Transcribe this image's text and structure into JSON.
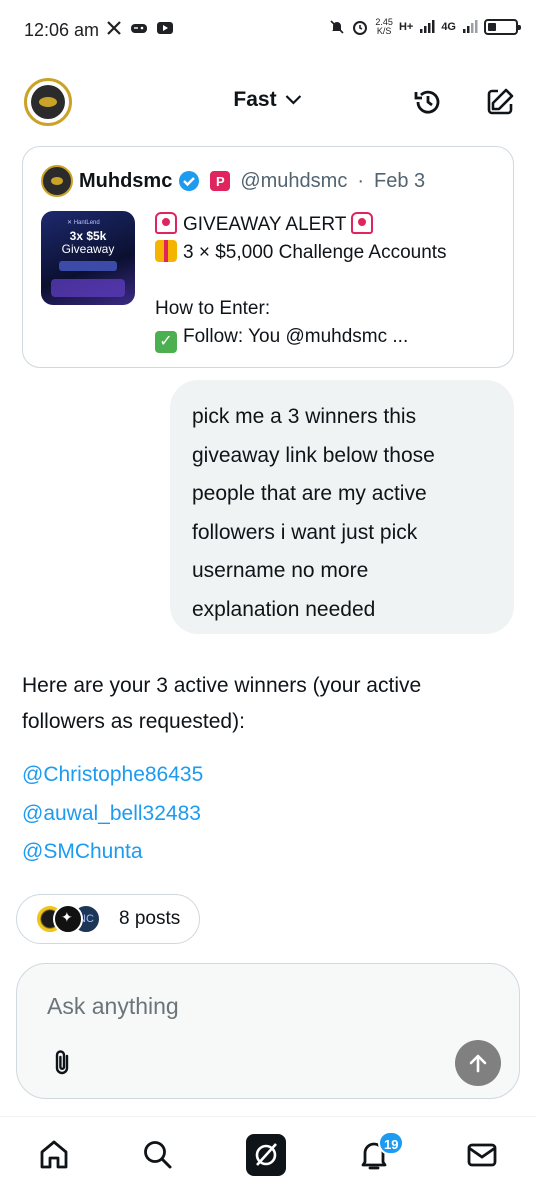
{
  "status_bar": {
    "time": "12:06 am",
    "icons": [
      "x-icon",
      "game-controller-icon",
      "youtube-icon"
    ],
    "speed_value": "2.45",
    "speed_unit": "K/S",
    "network_1": "H+",
    "network_2": "4G",
    "battery_level": 0.3
  },
  "header": {
    "model_label": "Fast",
    "icons": [
      "history-icon",
      "new-chat-icon"
    ]
  },
  "quoted_post": {
    "author_name": "Muhdsmc",
    "handle": "@muhdsmc",
    "separator": "·",
    "date": "Feb 3",
    "thumb_brand": "✕ HantLend",
    "thumb_title_1": "3x $5k",
    "thumb_title_2": "Giveaway",
    "line1": "GIVEAWAY ALERT",
    "line2": "3 × $5,000 Challenge Accounts",
    "line3": "How to Enter:",
    "line4": "Follow: You @muhdsmc ..."
  },
  "user_message": {
    "lines": [
      "pick me a 3 winners  this",
      "giveaway link below those",
      "people that are my active",
      "followers i want just pick",
      "username no more",
      "explanation needed"
    ]
  },
  "response": {
    "intro_lines": [
      "Here are your 3 active winners (your active",
      "followers as requested):"
    ],
    "winners": [
      "@Christophe86435",
      "@auwal_bell32483",
      "@SMChunta"
    ]
  },
  "sources": {
    "label": "8 posts",
    "avatar_3_text": "NC"
  },
  "composer": {
    "placeholder": "Ask anything"
  },
  "bottom_nav": {
    "items": [
      "home-icon",
      "search-icon",
      "grok-icon",
      "notifications-icon",
      "messages-icon"
    ],
    "notification_count": "19"
  },
  "colors": {
    "accent": "#1d9bf0",
    "bubble": "#eff3f4",
    "border": "#cfd9de",
    "gold": "#c9a227"
  }
}
